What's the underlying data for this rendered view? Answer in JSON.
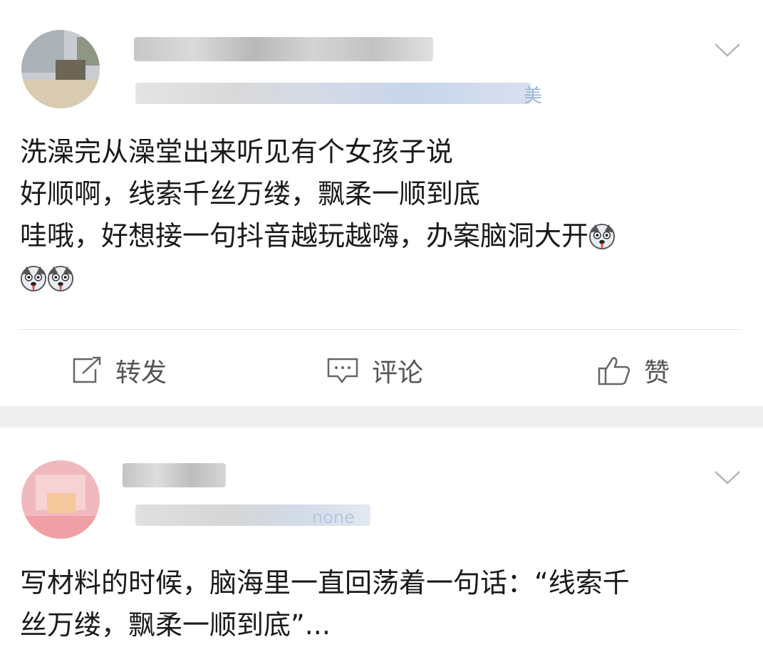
{
  "posts": [
    {
      "name_fragment": "…",
      "meta_fragment": "美",
      "body_lines": [
        "洗澡完从澡堂出来听见有个女孩子说",
        "好顺啊，线索千丝万缕，飘柔一顺到底",
        "哇哦，好想接一句抖音越玩越嗨，办案脑洞大开"
      ],
      "emoji_name": "husky-emoji",
      "actions": {
        "repost": "转发",
        "comment": "评论",
        "like": "赞"
      }
    },
    {
      "meta_fragment": "none",
      "body_lines": [
        "写材料的时候，脑海里一直回荡着一句话：“线索千",
        "丝万缕，飘柔一顺到底”..."
      ]
    }
  ],
  "colors": {
    "page_bg": "#ffffff",
    "separator": "#efefef",
    "text": "#1a1a1a",
    "action_text": "#555555",
    "link_blue": "#9cb4d8"
  }
}
